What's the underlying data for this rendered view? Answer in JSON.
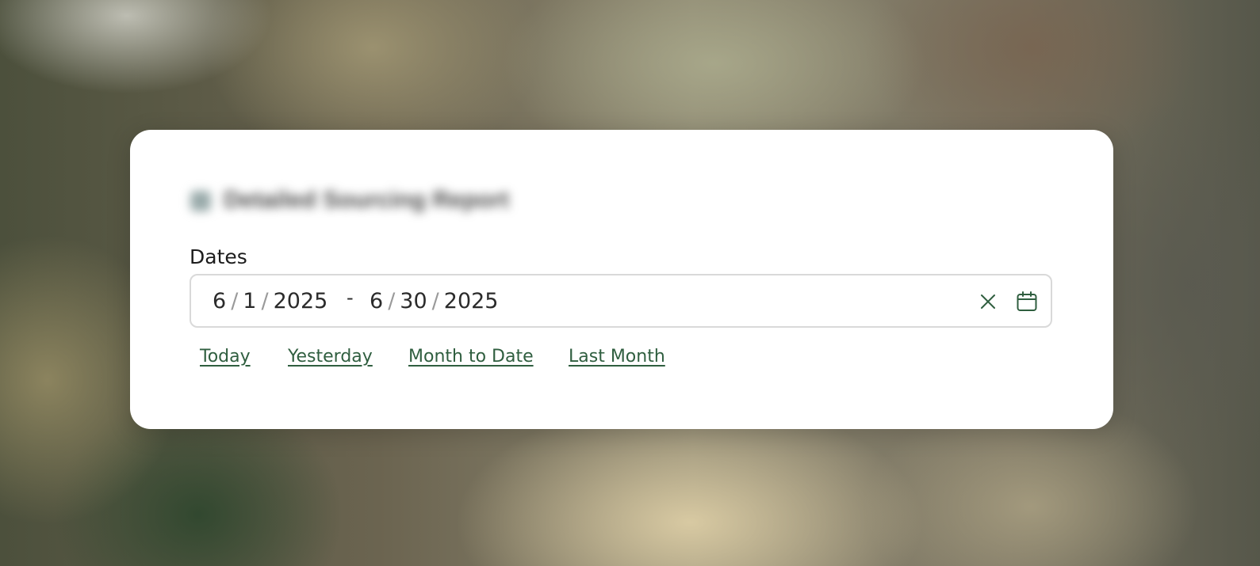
{
  "dialog": {
    "blurred_title": "Detailed Sourcing Report"
  },
  "dates_field": {
    "label": "Dates",
    "start": {
      "month": "6",
      "day": "1",
      "year": "2025"
    },
    "end": {
      "month": "6",
      "day": "30",
      "year": "2025"
    },
    "separator": "/",
    "range_separator": "-",
    "clear_icon": "close-icon",
    "calendar_icon": "calendar-icon"
  },
  "quick_ranges": [
    {
      "label": "Today"
    },
    {
      "label": "Yesterday"
    },
    {
      "label": "Month to Date"
    },
    {
      "label": "Last Month"
    }
  ],
  "colors": {
    "accent": "#2f5e3f",
    "text": "#2b2b2b",
    "border": "#d9d9d9"
  }
}
